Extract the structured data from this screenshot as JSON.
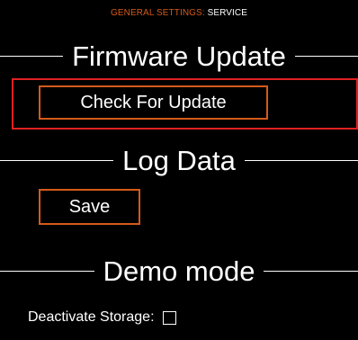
{
  "breadcrumb": {
    "parent": "GENERAL SETTINGS:",
    "current": "SERVICE"
  },
  "sections": {
    "firmware": {
      "title": "Firmware Update",
      "button_label": "Check For Update"
    },
    "log": {
      "title": "Log Data",
      "button_label": "Save"
    },
    "demo": {
      "title": "Demo mode",
      "checkbox_label": "Deactivate Storage:",
      "checkbox_checked": false
    }
  },
  "colors": {
    "background": "#000000",
    "accent": "#d45a1a",
    "focus": "#e02020",
    "text": "#ffffff"
  }
}
